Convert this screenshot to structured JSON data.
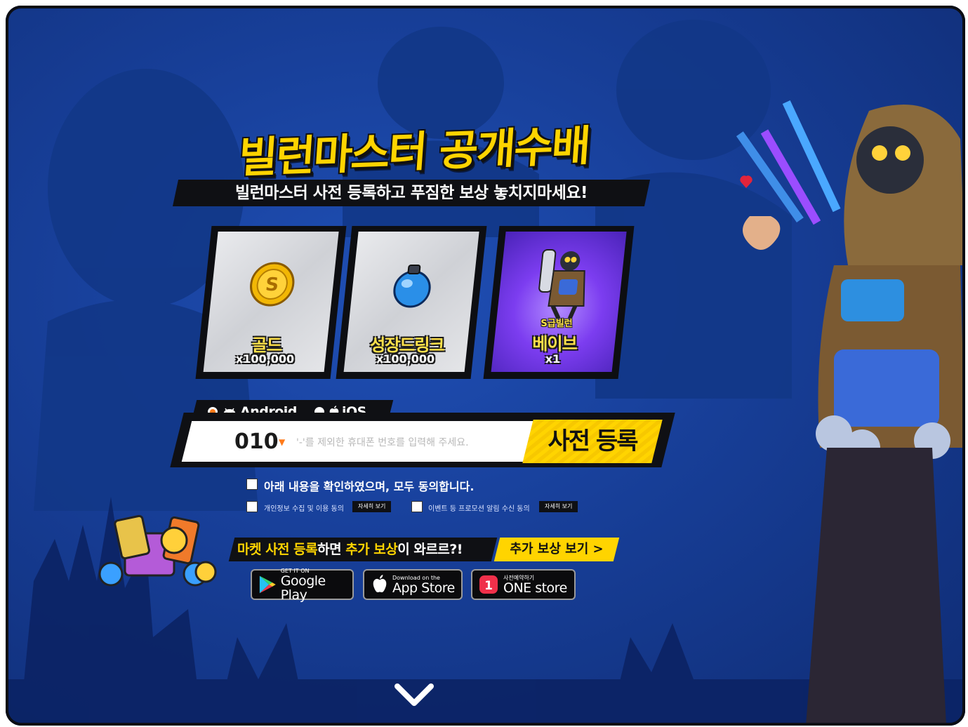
{
  "page": {
    "title": "빌런마스터 공개수배",
    "subtitle": "빌런마스터 사전 등록하고 푸짐한 보상 놓치지마세요!"
  },
  "rewards": [
    {
      "label": "골드",
      "qty": "x100,000",
      "icon": "gold-coin-icon"
    },
    {
      "label": "성장드링크",
      "qty": "x100,000",
      "icon": "growth-drink-icon"
    },
    {
      "tag": "S급빌런",
      "label": "베이브",
      "qty": "x1",
      "icon": "villain-character-icon"
    }
  ],
  "os": {
    "android_label": "Android",
    "ios_label": "iOS",
    "selected": "Android"
  },
  "phone": {
    "prefix": "010",
    "placeholder": "'-'를 제외한 휴대폰 번호를 입력해 주세요.",
    "value": ""
  },
  "register_button": "사전 등록",
  "agreements": {
    "all": "아래 내용을 확인하였으며, 모두 동의합니다.",
    "privacy": "개인정보 수집 및 이용 동의",
    "event": "이벤트 등 프로모션 알림 수신 동의",
    "detail_label": "자세히 보기"
  },
  "market": {
    "text_1": "마켓 사전 등록",
    "text_2": "하면 ",
    "text_3": "추가 보상",
    "text_4": "이 와르르?!",
    "more_button": "추가 보상 보기 >"
  },
  "stores": [
    {
      "small": "GET IT ON",
      "big": "Google Play",
      "icon": "google-play-icon"
    },
    {
      "small": "Download on the",
      "big": "App Store",
      "icon": "apple-icon"
    },
    {
      "small": "사전예약하기",
      "big": "ONE store",
      "icon": "onestore-icon"
    }
  ],
  "colors": {
    "background": "#173e97",
    "accent_yellow": "#ffd400",
    "dark_panel": "#0f1014",
    "radio_selected": "#ff7b1a"
  }
}
